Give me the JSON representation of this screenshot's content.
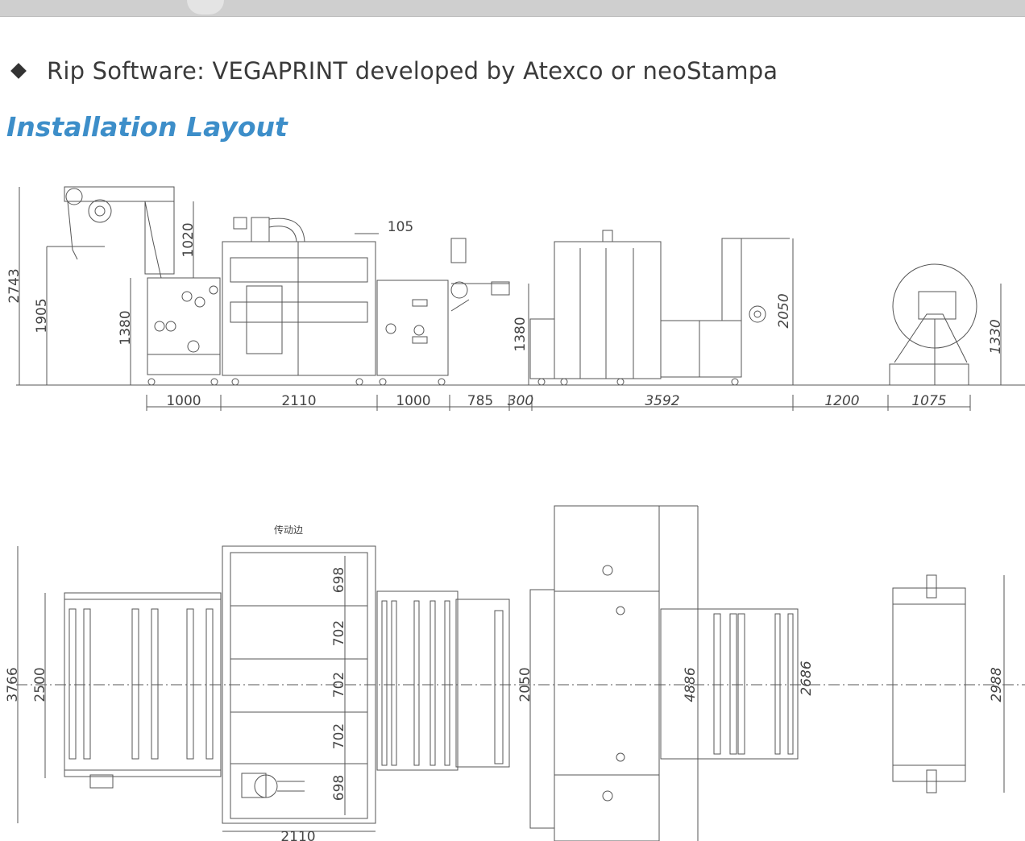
{
  "bullet": {
    "text": "Rip Software: VEGAPRINT developed by Atexco or neoStampa",
    "icon": "diamond-bullet-icon"
  },
  "section": {
    "title": "Installation Layout",
    "color": "#3d8ec9"
  },
  "side_view": {
    "heights": {
      "h2743": "2743",
      "h1905": "1905",
      "h1380a": "1380",
      "h1020": "1020",
      "h1380b": "1380",
      "h2050": "2050",
      "h1330": "1330",
      "h105": "105"
    },
    "widths": {
      "w1000a": "1000",
      "w2110": "2110",
      "w1000b": "1000",
      "w785": "785",
      "w300": "300",
      "w3592": "3592",
      "w1200": "1200",
      "w1075": "1075"
    }
  },
  "top_view": {
    "label_cn": "传动边",
    "dims": {
      "d3766": "3766",
      "d2500": "2500",
      "d698a": "698",
      "d702a": "702",
      "d702b": "702",
      "d702c": "702",
      "d698b": "698",
      "d2050": "2050",
      "d4886": "4886",
      "d2686": "2686",
      "d2988": "2988",
      "d2110": "2110"
    }
  }
}
